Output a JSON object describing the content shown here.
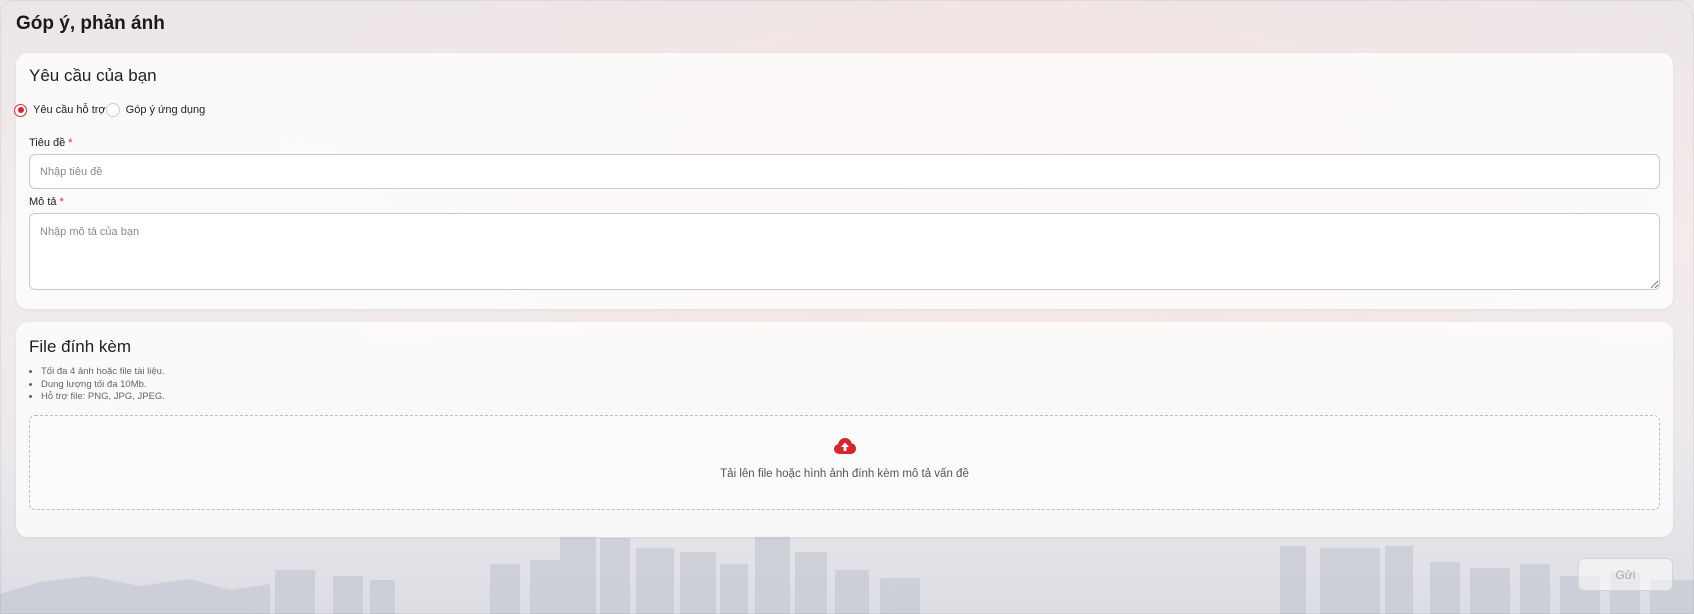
{
  "page": {
    "title": "Góp ý, phản ánh"
  },
  "request_section": {
    "title": "Yêu cầu của bạn",
    "request_type": {
      "options": [
        "Yêu cầu hỗ trợ",
        "Góp ý ứng dụng"
      ],
      "selected": "Yêu cầu hỗ trợ"
    },
    "title_field": {
      "label": "Tiêu đề",
      "required_mark": "*",
      "placeholder": "Nhập tiêu đề",
      "value": ""
    },
    "description_field": {
      "label": "Mô tả",
      "required_mark": "*",
      "placeholder": "Nhập mô tả của bạn",
      "value": ""
    }
  },
  "attachment_section": {
    "title": "File đính kèm",
    "notes": [
      "Tối đa 4 ảnh hoặc file tài liệu.",
      "Dung lượng tối đa 10Mb.",
      "Hỗ trợ file: PNG, JPG, JPEG."
    ],
    "dropzone": {
      "icon": "cloud-upload-icon",
      "text": "Tải lên file hoặc hình ảnh đính kèm mô tả vấn đề"
    }
  },
  "actions": {
    "submit_label": "Gửi",
    "submit_disabled": true
  },
  "colors": {
    "accent": "#d8262f",
    "required": "#e0282e",
    "disabled_text": "#a6a6a6"
  }
}
